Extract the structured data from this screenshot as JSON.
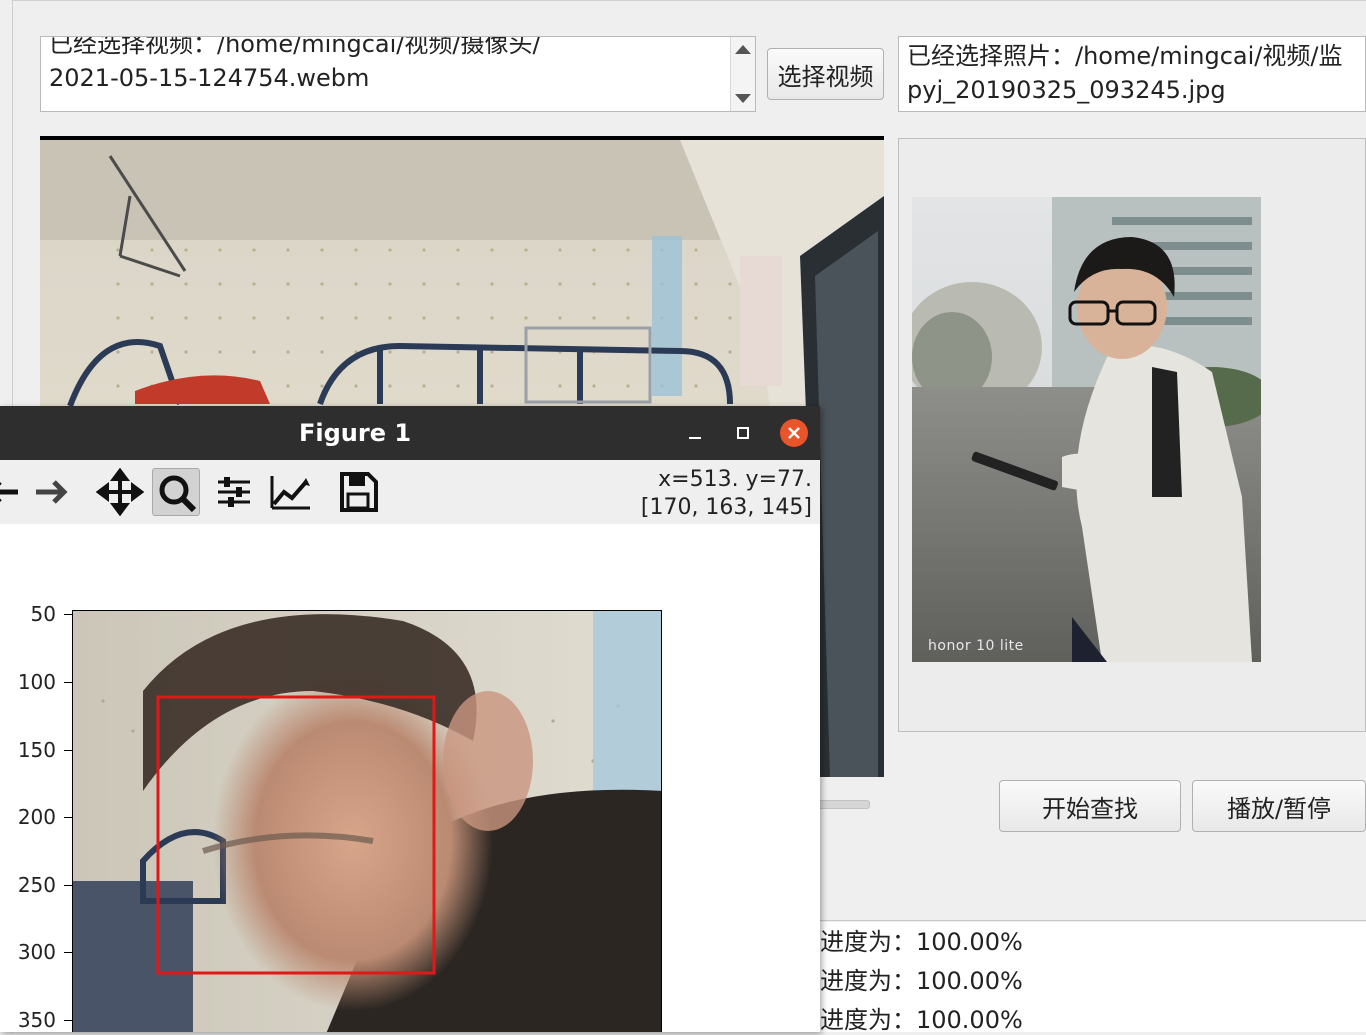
{
  "main_window": {
    "video_path_lines": [
      "已经选择视频：/home/mingcai/视频/摄像头/",
      "2021-05-15-124754.webm"
    ],
    "photo_path_lines": [
      "已经选择照片：/home/mingcai/视频/监",
      "pyj_20190325_093245.jpg"
    ],
    "select_video_label": "选择视频",
    "start_search_label": "开始查找",
    "play_pause_label": "播放/暂停",
    "photo_watermark": "honor 10 lite",
    "log_lines": [
      "进度为：100.00%",
      "进度为：100.00%",
      "进度为：100.00%"
    ]
  },
  "figure": {
    "title": "Figure 1",
    "coord_line1": "x=513. y=77.",
    "coord_line2": "[170, 163, 145]",
    "yticks": [
      "50",
      "100",
      "150",
      "200",
      "250",
      "300",
      "350"
    ],
    "face_box_color": "#e01818",
    "toolbar_icons": [
      "back-arrow-icon",
      "forward-arrow-icon",
      "pan-icon",
      "zoom-icon",
      "subplots-config-icon",
      "edit-axis-icon",
      "save-icon"
    ]
  },
  "colors": {
    "close_button": "#e9542b",
    "titlebar": "#2e2e2e"
  }
}
